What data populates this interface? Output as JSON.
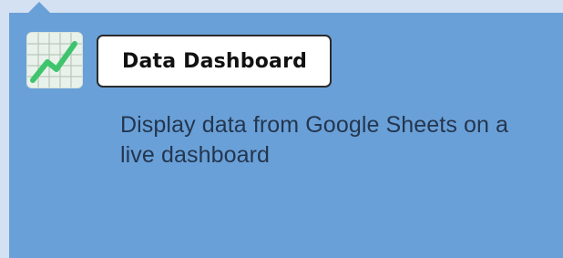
{
  "card": {
    "title": "Data Dashboard",
    "description": "Display data from Google Sheets on a live dashboard"
  },
  "icon": {
    "name": "trending-chart-icon"
  },
  "colors": {
    "page_bg": "#d3e1f2",
    "card_bg": "#6aa0d8",
    "chip_bg": "#ffffff",
    "chip_border": "#2b2b2b",
    "icon_line": "#3ec46d",
    "icon_grid": "#b9c7bc"
  }
}
